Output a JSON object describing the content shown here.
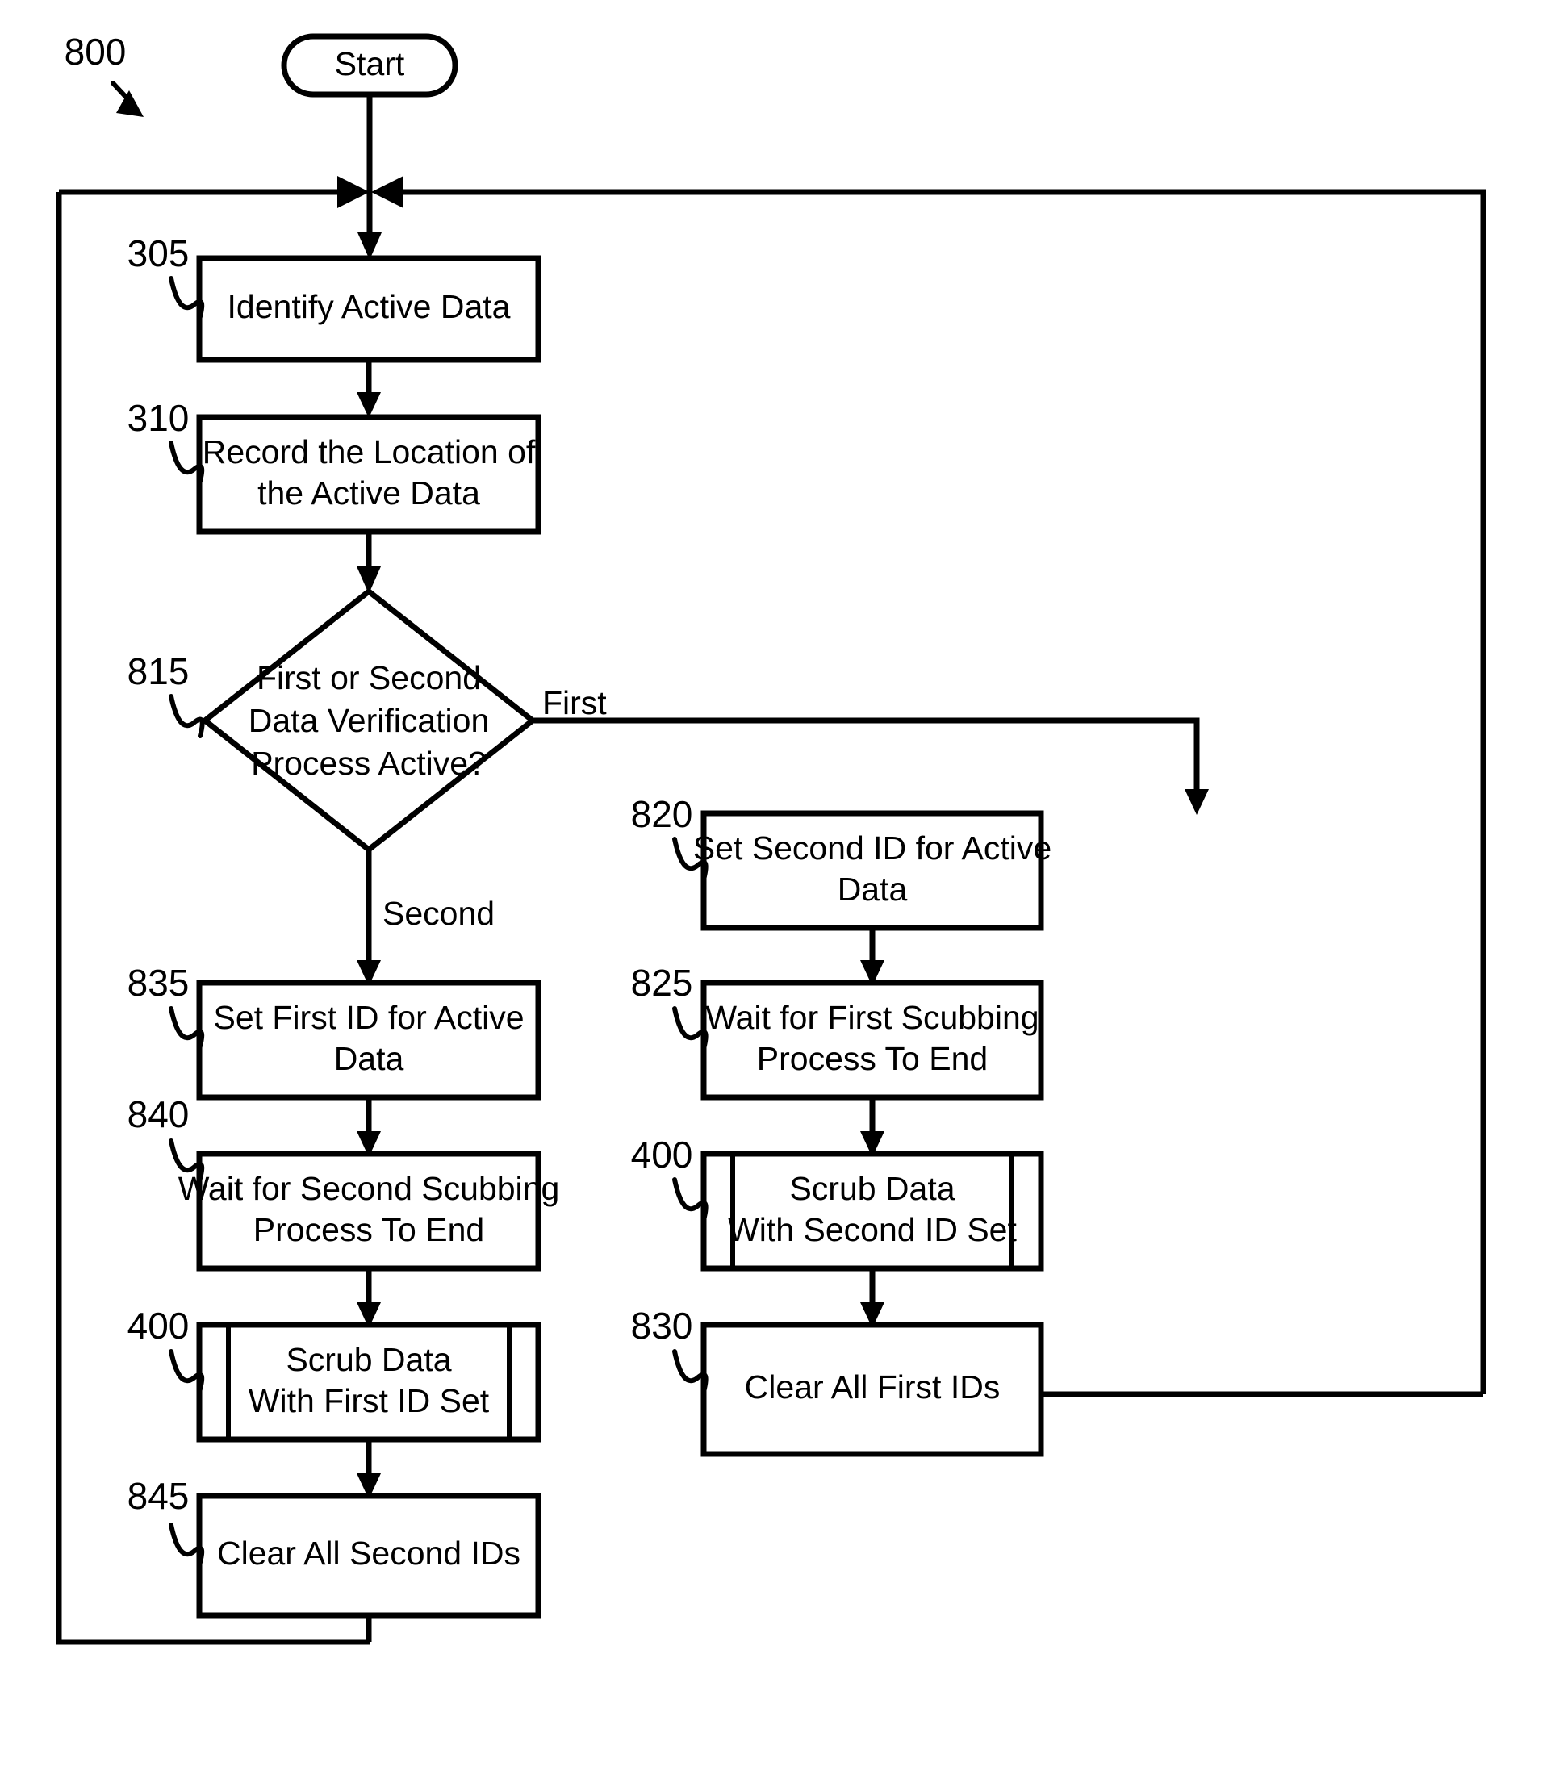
{
  "figure": {
    "number": "800",
    "type": "flowchart"
  },
  "terminal": {
    "start_label": "Start"
  },
  "nodes": [
    {
      "ref": "305",
      "label_line1": "Identify Active Data",
      "label_line2": "",
      "shape": "process"
    },
    {
      "ref": "310",
      "label_line1": "Record the Location of",
      "label_line2": "the Active Data",
      "shape": "process"
    },
    {
      "ref": "815",
      "label_line1": "First or Second",
      "label_line2": "Data Verification",
      "label_line3": "Process Active?",
      "shape": "decision"
    },
    {
      "ref": "820",
      "label_line1": "Set Second ID for Active",
      "label_line2": "Data",
      "shape": "process"
    },
    {
      "ref": "825",
      "label_line1": "Wait for First Scubbing",
      "label_line2": "Process To End",
      "shape": "process"
    },
    {
      "ref": "400",
      "label_line1": "Scrub Data",
      "label_line2": "With Second ID Set",
      "shape": "predefined-process"
    },
    {
      "ref": "830",
      "label_line1": "Clear All First IDs",
      "label_line2": "",
      "shape": "process"
    },
    {
      "ref": "835",
      "label_line1": "Set First ID for Active",
      "label_line2": "Data",
      "shape": "process"
    },
    {
      "ref": "840",
      "label_line1": "Wait for Second Scubbing",
      "label_line2": "Process To End",
      "shape": "process"
    },
    {
      "ref": "400b",
      "ref_display": "400",
      "label_line1": "Scrub Data",
      "label_line2": "With First ID Set",
      "shape": "predefined-process"
    },
    {
      "ref": "845",
      "label_line1": "Clear All Second IDs",
      "label_line2": "",
      "shape": "process"
    }
  ],
  "branch_labels": {
    "first": "First",
    "second": "Second"
  },
  "colors": {
    "stroke": "#000000",
    "fill": "#ffffff",
    "background": "#ffffff"
  }
}
